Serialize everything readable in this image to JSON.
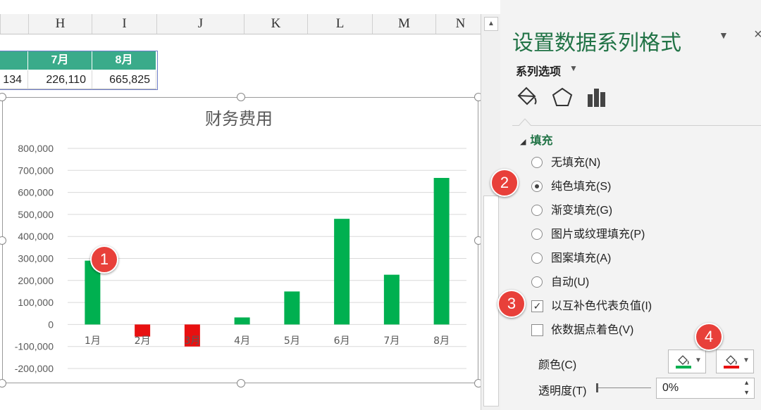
{
  "sheet": {
    "columns": [
      "H",
      "I",
      "J",
      "K",
      "L",
      "M",
      "N"
    ],
    "table": {
      "headers": [
        "",
        "7月",
        "8月"
      ],
      "values": [
        "134",
        "226,110",
        "665,825"
      ]
    }
  },
  "chart_data": {
    "type": "bar",
    "title": "财务费用",
    "categories": [
      "1月",
      "2月",
      "3月",
      "4月",
      "5月",
      "6月",
      "7月",
      "8月"
    ],
    "values": [
      290000,
      -55000,
      -100000,
      32000,
      150000,
      480000,
      226110,
      665825
    ],
    "ylim": [
      -200000,
      800000
    ],
    "yticks": [
      "800,000",
      "700,000",
      "600,000",
      "500,000",
      "400,000",
      "300,000",
      "200,000",
      "100,000",
      "0",
      "-100,000",
      "-200,000"
    ],
    "positive_color": "#00b050",
    "negative_color": "#e81010",
    "grid": true
  },
  "pane": {
    "title": "设置数据系列格式",
    "section": "系列选项",
    "fill_header": "填充",
    "options": {
      "no_fill": "无填充(N)",
      "solid": "纯色填充(S)",
      "gradient": "渐变填充(G)",
      "picture": "图片或纹理填充(P)",
      "pattern": "图案填充(A)",
      "auto": "自动(U)",
      "invert": "以互补色代表负值(I)",
      "vary": "依数据点着色(V)"
    },
    "color_label": "颜色(C)",
    "transparency_label": "透明度(T)",
    "transparency_value": "0%",
    "color1": "#00b050",
    "color2": "#e81010"
  },
  "badges": [
    "1",
    "2",
    "3",
    "4"
  ]
}
